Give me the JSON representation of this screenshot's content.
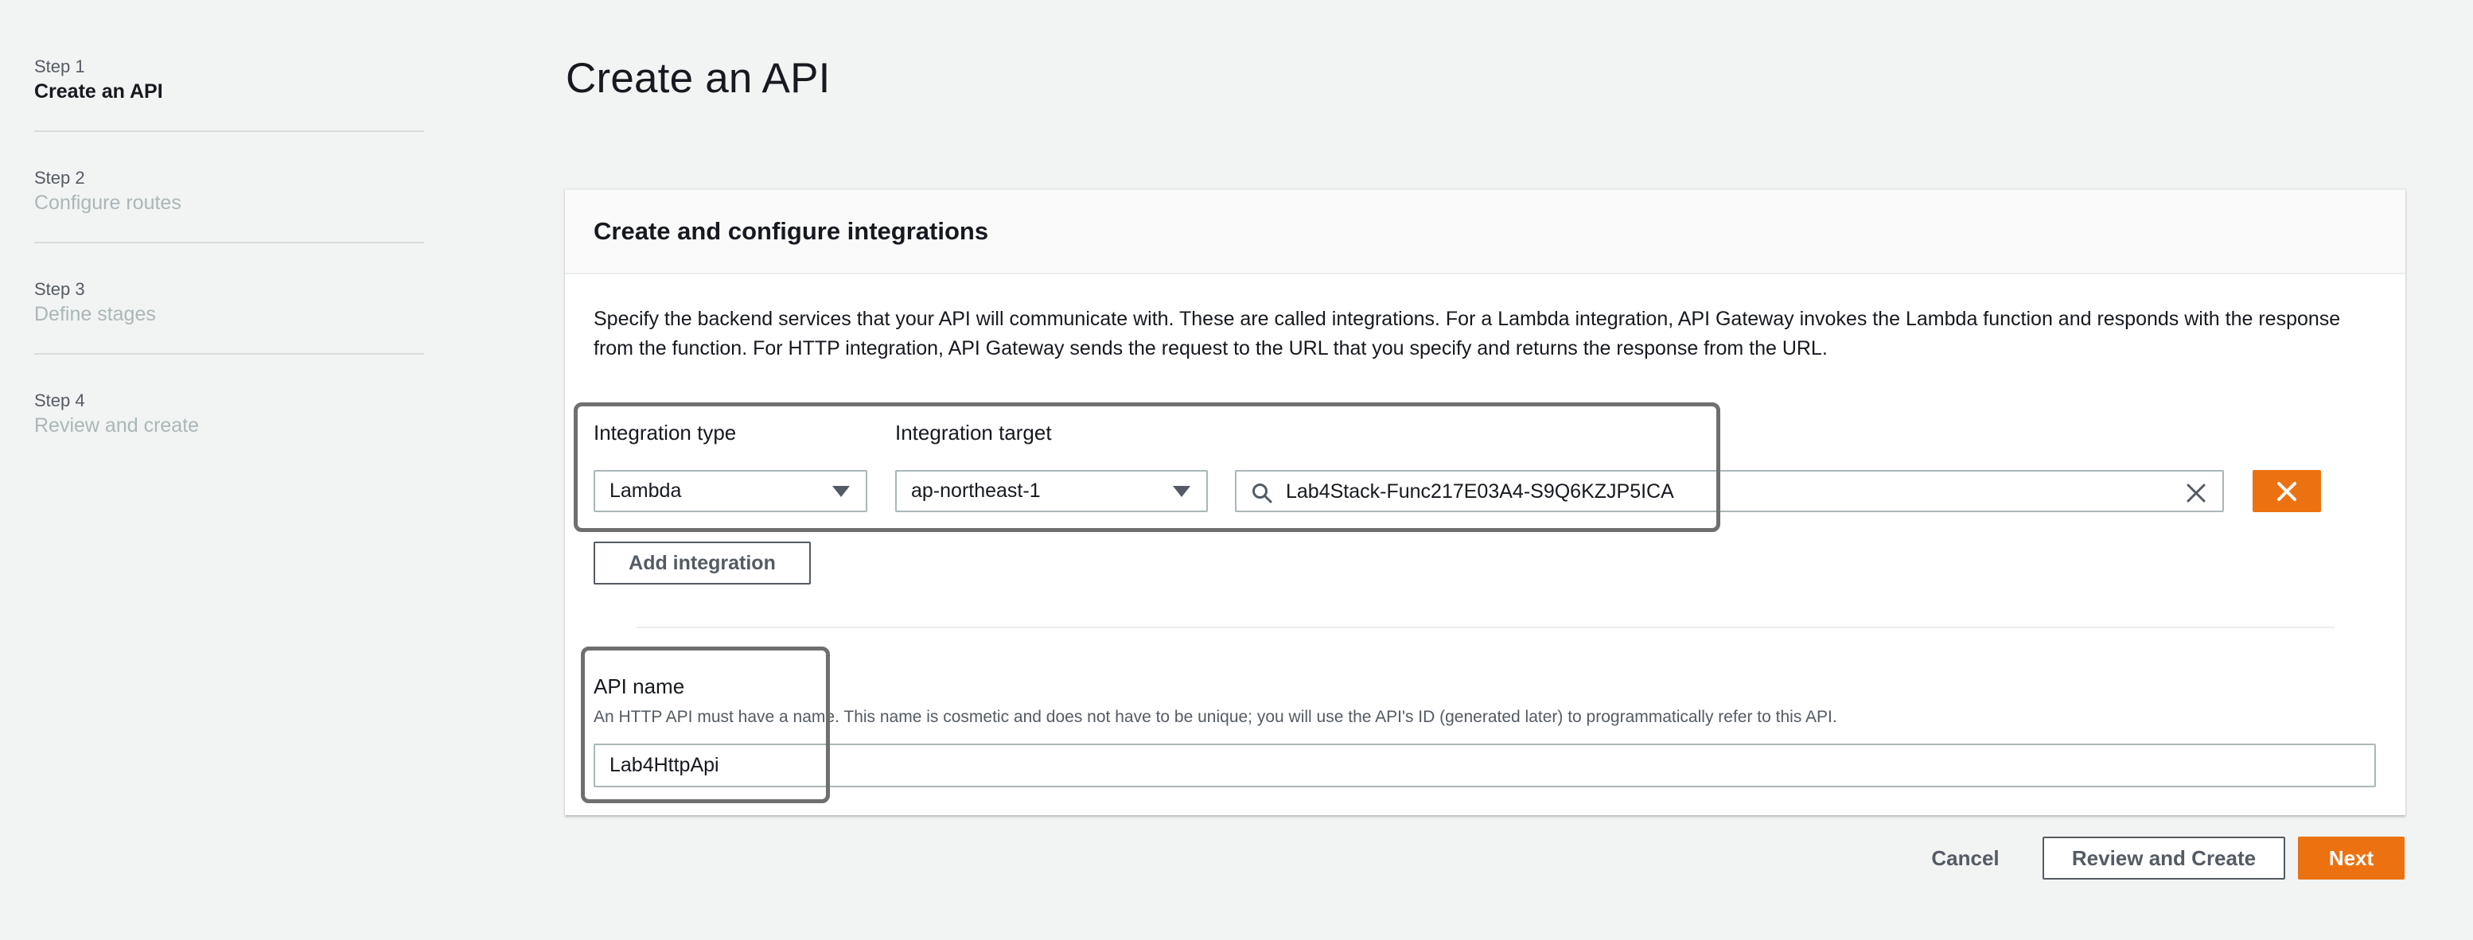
{
  "steps": [
    {
      "num": "Step 1",
      "title": "Create an API",
      "active": true
    },
    {
      "num": "Step 2",
      "title": "Configure routes",
      "active": false
    },
    {
      "num": "Step 3",
      "title": "Define stages",
      "active": false
    },
    {
      "num": "Step 4",
      "title": "Review and create",
      "active": false
    }
  ],
  "page_title": "Create an API",
  "panel": {
    "title": "Create and configure integrations",
    "description": "Specify the backend services that your API will communicate with. These are called integrations. For a Lambda integration, API Gateway invokes the Lambda function and responds with the response from the function. For HTTP integration, API Gateway sends the request to the URL that you specify and returns the response from the URL.",
    "integration_type_label": "Integration type",
    "integration_target_label": "Integration target",
    "integration_type_value": "Lambda",
    "region_value": "ap-northeast-1",
    "function_value": "Lab4Stack-Func217E03A4-S9Q6KZJP5ICA",
    "add_integration_label": "Add integration",
    "api_name_label": "API name",
    "api_name_hint": "An HTTP API must have a name. This name is cosmetic and does not have to be unique; you will use the API's ID (generated later) to programmatically refer to this API.",
    "api_name_value": "Lab4HttpApi"
  },
  "footer": {
    "cancel_label": "Cancel",
    "review_label": "Review and Create",
    "next_label": "Next"
  },
  "colors": {
    "accent": "#ec7211",
    "background": "#f2f3f3",
    "highlight_outline": "#6f6f6f"
  },
  "icons": {
    "select_caret": "caret-down-icon",
    "search": "search-icon",
    "clear": "close-icon",
    "remove": "close-icon"
  }
}
